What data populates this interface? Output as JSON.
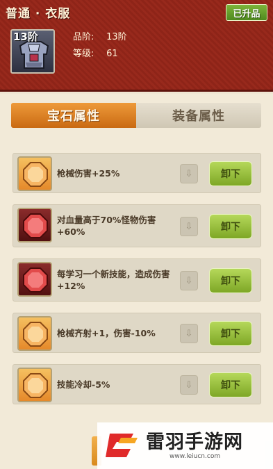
{
  "header": {
    "title": "普通 · 衣服",
    "badge": "已升品",
    "item_level": "13阶",
    "stats": [
      {
        "label": "品阶:",
        "value": "13阶"
      },
      {
        "label": "等级:",
        "value": "61"
      }
    ]
  },
  "tabs": [
    {
      "label": "宝石属性",
      "active": true
    },
    {
      "label": "装备属性",
      "active": false
    }
  ],
  "gems": [
    {
      "color": "orange",
      "text": "枪械伤害+25%",
      "button": "卸下"
    },
    {
      "color": "red",
      "text": "对血量高于70%怪物伤害+60%",
      "button": "卸下"
    },
    {
      "color": "red",
      "text": "每学习一个新技能，造成伤害+12%",
      "button": "卸下"
    },
    {
      "color": "orange",
      "text": "枪械齐射+1，伤害-10%",
      "button": "卸下"
    },
    {
      "color": "orange",
      "text": "技能冷却-5%",
      "button": "卸下"
    }
  ],
  "watermark": {
    "brand": "雷羽手游网",
    "url": "www.leiucn.com"
  },
  "colors": {
    "header_bg": "#8e2418",
    "accent_orange": "#e5892a",
    "button_green": "#8cb530"
  }
}
